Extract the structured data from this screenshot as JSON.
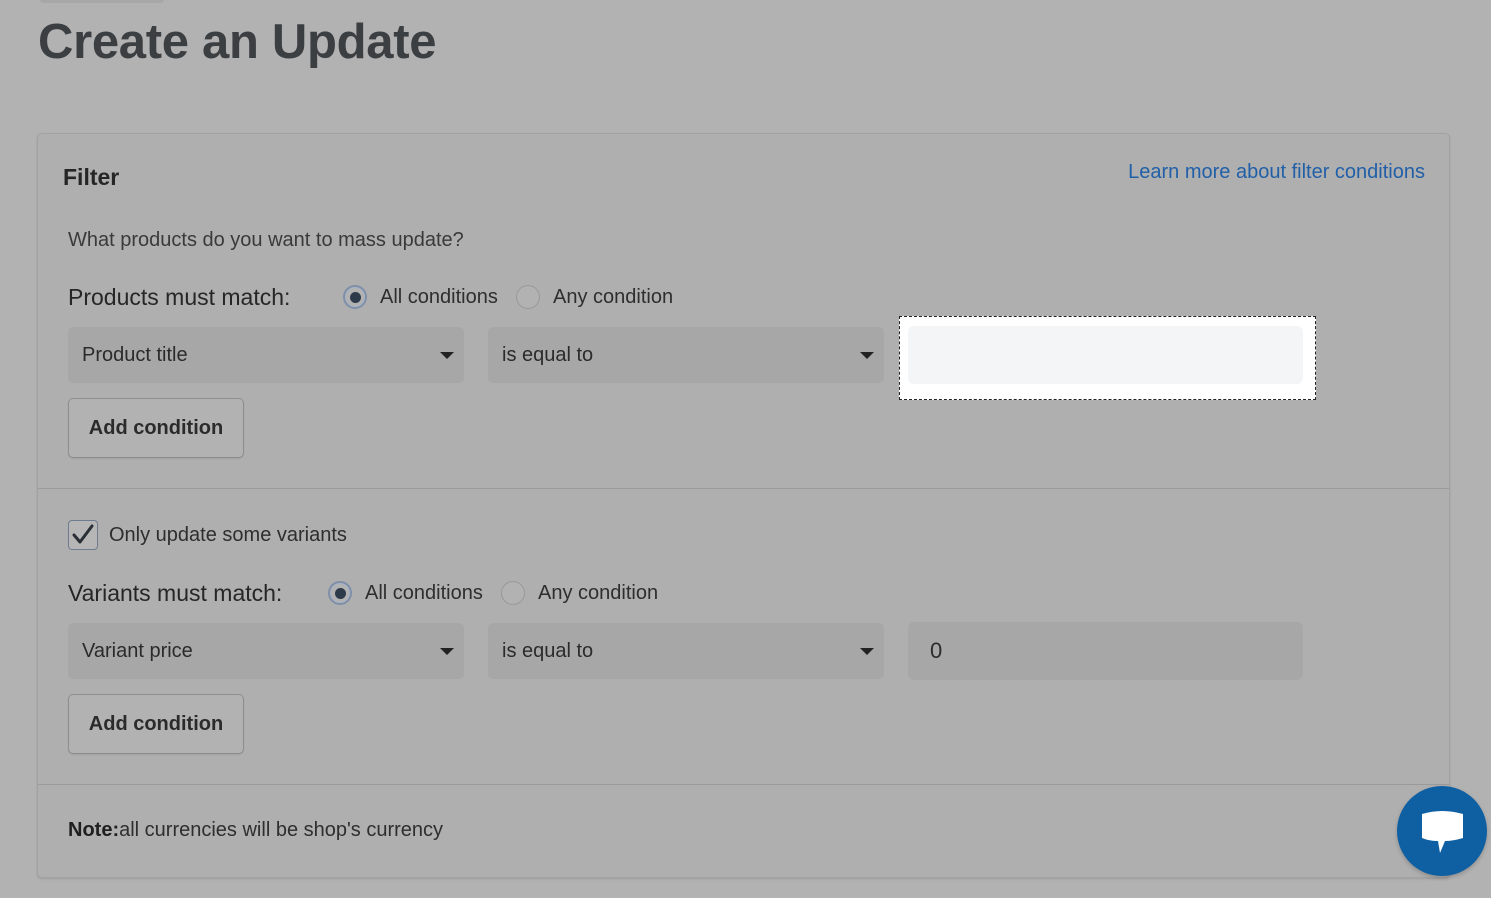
{
  "page": {
    "title": "Create an Update"
  },
  "filter": {
    "heading": "Filter",
    "learn_more_link": "Learn more about filter conditions",
    "question": "What products do you want to mass update?",
    "products": {
      "match_label": "Products must match:",
      "options": [
        "All conditions",
        "Any condition"
      ],
      "selected": "All conditions",
      "field_select": "Product title",
      "operator_select": "is equal to",
      "value": "",
      "add_condition": "Add condition"
    },
    "variants": {
      "checkbox_label": "Only update some variants",
      "checked": true,
      "match_label": "Variants must match:",
      "options": [
        "All conditions",
        "Any condition"
      ],
      "selected": "All conditions",
      "field_select": "Variant price",
      "operator_select": "is equal to",
      "value": "0",
      "add_condition": "Add condition"
    },
    "note": {
      "label": "Note:",
      "text": "all currencies will be shop's currency"
    }
  },
  "colors": {
    "link": "#2160a8",
    "chat_button": "#0f5fa3",
    "overlay_background": "#b2b2b2"
  },
  "icons": {
    "chat": "chat-bubble-icon",
    "check": "checkmark-icon",
    "caret": "caret-down-icon"
  }
}
